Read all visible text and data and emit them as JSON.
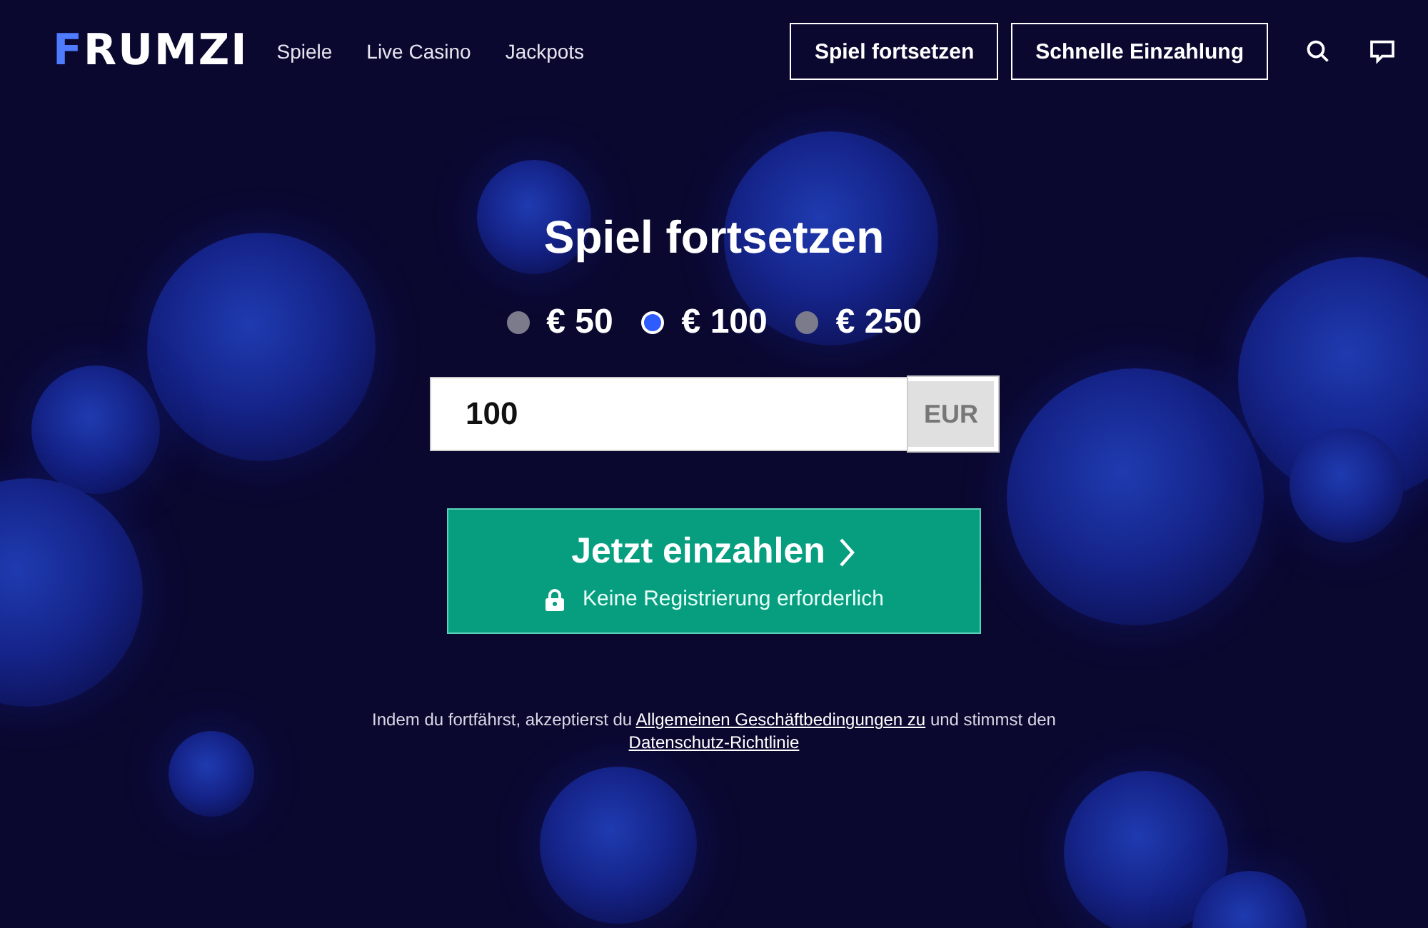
{
  "logo": {
    "accent": "F",
    "rest": "RUMZI"
  },
  "nav": [
    "Spiele",
    "Live Casino",
    "Jackpots"
  ],
  "header_buttons": [
    "Spiel fortsetzen",
    "Schnelle Einzahlung"
  ],
  "title": "Spiel fortsetzen",
  "amounts": [
    {
      "label": "€ 50",
      "selected": false
    },
    {
      "label": "€ 100",
      "selected": true
    },
    {
      "label": "€ 250",
      "selected": false
    }
  ],
  "amount_field": {
    "value": "100",
    "currency": "EUR"
  },
  "deposit_button": {
    "label": "Jetzt einzahlen",
    "note": "Keine Registrierung erforderlich"
  },
  "legal": {
    "before": "Indem du fortfährst, akzeptierst du",
    "terms_link": "Allgemeinen Geschäftbedingungen zu",
    "middle": "und stimmst den",
    "privacy_link": "Datenschutz-Richtlinie"
  }
}
